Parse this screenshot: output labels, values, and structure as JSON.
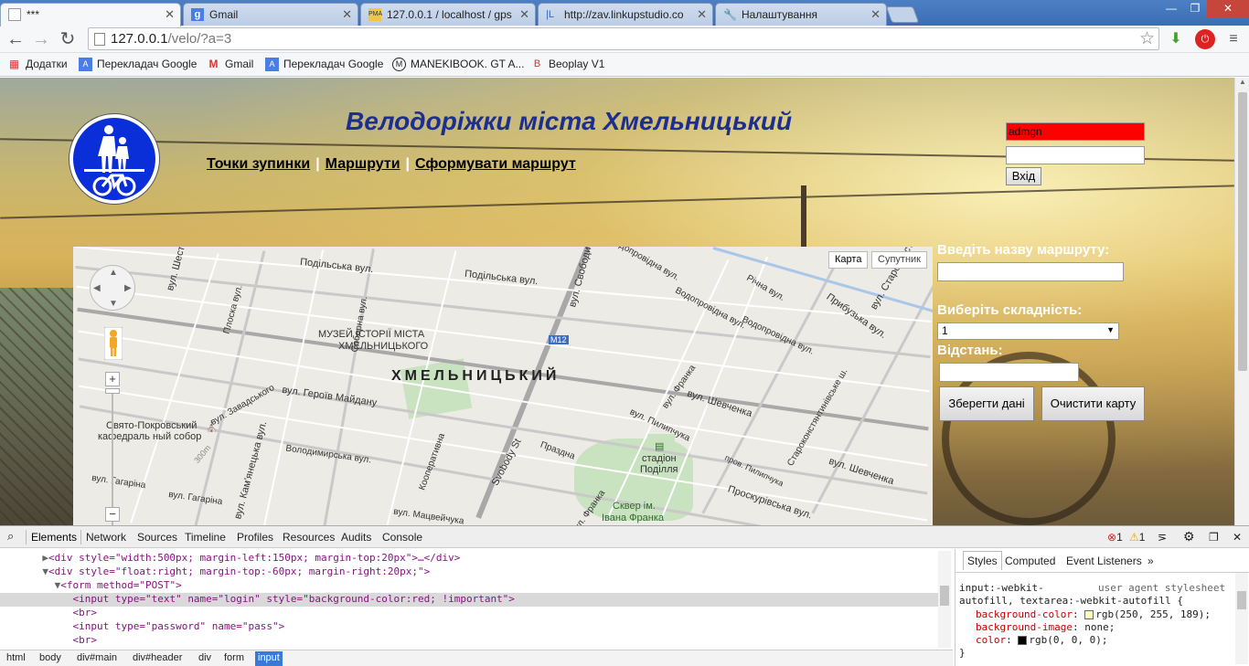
{
  "tabs": [
    {
      "title": "***",
      "active": true
    },
    {
      "title": "Gmail",
      "active": false
    },
    {
      "title": "127.0.0.1 / localhost / gps",
      "active": false
    },
    {
      "title": "http://zav.linkupstudio.co",
      "active": false
    },
    {
      "title": "Налаштування",
      "active": false
    }
  ],
  "address": {
    "host": "127.0.0.1",
    "path": "/velo/?a=3"
  },
  "bookmarks": [
    {
      "label": "Додатки"
    },
    {
      "label": "Перекладач Google"
    },
    {
      "label": "Gmail"
    },
    {
      "label": "Перекладач Google"
    },
    {
      "label": "MANEKIBOOK. GT A..."
    },
    {
      "label": "Beoplay V1"
    }
  ],
  "site": {
    "title": "Велодоріжки міста Хмельницький",
    "nav": [
      "Точки зупинки",
      "Маршрути",
      "Сформувати маршрут"
    ],
    "nav_separator": "|"
  },
  "login": {
    "username_value": "admgn",
    "password_value": "",
    "submit_label": "Вхід"
  },
  "map": {
    "type_buttons": [
      "Карта",
      "Супутник"
    ],
    "city_label": "ХМЕЛЬНИЦЬКИЙ",
    "zoom_in": "+",
    "zoom_out": "−",
    "labels": {
      "l1": "Подільська вул.",
      "l2": "Подільська вул.",
      "l3": "вул. Шестакова",
      "l4": "Плоска вул.",
      "l5": "Соборна вул.",
      "l6": "вул. Свободи",
      "l7": "Водопровідна вул.",
      "l8": "Водопровідна вул.",
      "l9": "Водопровідна вул.",
      "l10": "Річна вул.",
      "l11": "Прибузька вул.",
      "l12": "вул. Староконстянт",
      "l13": "МУЗЕЙ ІСТОРІЇ МІСТА",
      "l14": "ХМЕЛЬНИЦЬКОГО",
      "l15": "M12",
      "l16": "вул. Завадського",
      "l17": "вул. Героїв Майдану",
      "l18": "Свято-Покровський",
      "l19": "кафедраль ный собор",
      "l20": "вул. Кам'янецька вул.",
      "l21": "Володимирська вул.",
      "l22": "вул. Гагаріна",
      "l23": "вул. Гагаріна",
      "l24": "Svobody St",
      "l25": "вул. Франка",
      "l26": "вул. Пилипчука",
      "l27": "вул. Шевченка",
      "l28": "вул. Шевченка",
      "l29": "стадіон",
      "l30": "Поділля",
      "l31": "Сквер ім.",
      "l32": "Івана Франка",
      "l33": "Проскурівська вул.",
      "l34": "Староконстянтинівське ш.",
      "l35": "вул. Франка",
      "l36": "пров. Пилипчука",
      "l37": "300m",
      "l38": "Кооперативна",
      "l39": "Праздна",
      "l40": "вул. Мацвейчука"
    }
  },
  "route_form": {
    "name_label": "Введіть назву маршруту:",
    "difficulty_label": "Виберіть складність:",
    "difficulty_value": "1",
    "distance_label": "Відстань:",
    "save_label": "Зберегти дані",
    "clear_label": "Очистити карту"
  },
  "devtools": {
    "tabs": [
      "Elements",
      "Network",
      "Sources",
      "Timeline",
      "Profiles",
      "Resources",
      "Audits",
      "Console"
    ],
    "errors": "1",
    "warnings": "1",
    "code_lines": [
      {
        "indent": "       ",
        "tri": "▶",
        "text": "<div style=\"width:500px; margin-left:150px; margin-top:20px\">…</div>",
        "selected": false
      },
      {
        "indent": "       ",
        "tri": "▼",
        "text": "<div style=\"float:right; margin-top:-60px; margin-right:20px;\">",
        "selected": false
      },
      {
        "indent": "         ",
        "tri": "▼",
        "text": "<form method=\"POST\">",
        "selected": false
      },
      {
        "indent": "            ",
        "tri": "",
        "text": "<input type=\"text\" name=\"login\" style=\"background-color:red; !important\">",
        "selected": true
      },
      {
        "indent": "            ",
        "tri": "",
        "text": "<br>",
        "selected": false
      },
      {
        "indent": "            ",
        "tri": "",
        "text": "<input type=\"password\" name=\"pass\">",
        "selected": false
      },
      {
        "indent": "            ",
        "tri": "",
        "text": "<br>",
        "selected": false
      }
    ],
    "breadcrumbs": [
      "html",
      "body",
      "div#main",
      "div#header",
      "div",
      "form",
      "input"
    ],
    "side_tabs": [
      "Styles",
      "Computed",
      "Event Listeners"
    ],
    "css": {
      "selector_line1": "input:-webkit-",
      "origin": "user agent stylesheet",
      "selector_line2": "autofill, textarea:-webkit-autofill {",
      "decl1_prop": "background-color",
      "decl1_val": "rgb(250, 255, 189);",
      "decl2_prop": "background-image",
      "decl2_val": "none;",
      "decl3_prop": "color",
      "decl3_val": "rgb(0, 0, 0);",
      "close": "}"
    }
  },
  "colors": {
    "login_bg": "#ff0000",
    "title": "#1c2e8e",
    "sign_blue": "#0a2fd8",
    "devtools_selection": "#3879d9"
  }
}
